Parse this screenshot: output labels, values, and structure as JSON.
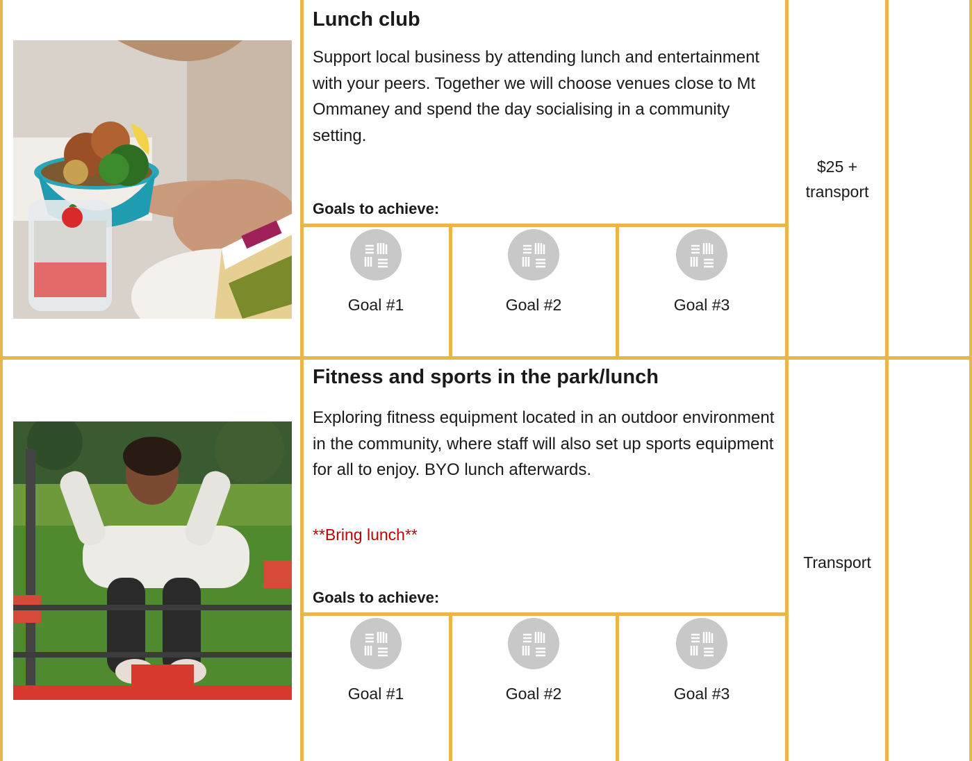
{
  "activities": [
    {
      "title": "Lunch club",
      "description": "Support local business by attending lunch and entertainment with your peers. Together we will choose venues close to Mt Ommaney and spend the day socialising in a community setting.",
      "note": "",
      "goals_heading": "Goals to achieve:",
      "goals": [
        "Goal #1",
        "Goal #2",
        "Goal #3"
      ],
      "cost_line1": "$25 +",
      "cost_line2": "transport",
      "image": "food-bowl-photo"
    },
    {
      "title": "Fitness and sports in the park/lunch",
      "description": "Exploring fitness equipment located in an outdoor environment in the community, where staff will also set up sports equipment for all to enjoy. BYO lunch afterwards.",
      "note": "**Bring lunch**",
      "goals_heading": "Goals to achieve:",
      "goals": [
        "Goal #1",
        "Goal #2",
        "Goal #3"
      ],
      "cost_line1": "Transport",
      "cost_line2": "",
      "image": "outdoor-fitness-photo"
    }
  ],
  "icons": {
    "goal": "teamwork-hands-icon"
  },
  "colors": {
    "border": "#e8b64a",
    "note": "#c00000",
    "icon_bg": "#c8c8c8"
  }
}
